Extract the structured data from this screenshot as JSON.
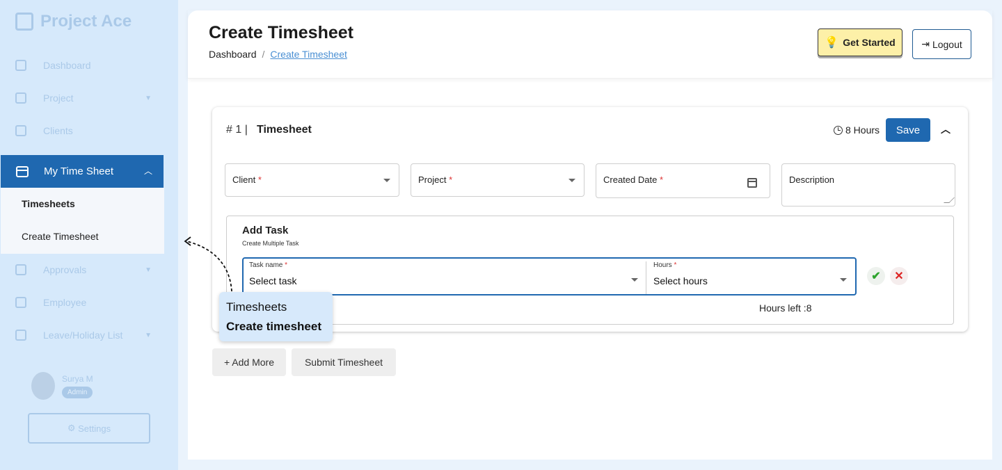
{
  "sidebar": {
    "logo_text": "Project Ace",
    "items": [
      {
        "label": "Dashboard",
        "icon": "dashboard-icon"
      },
      {
        "label": "Project",
        "icon": "project-icon"
      },
      {
        "label": "Clients",
        "icon": "clients-icon"
      },
      {
        "label": "My Time Sheet",
        "icon": "calendar-icon"
      },
      {
        "label": "Approvals",
        "icon": "approvals-icon"
      },
      {
        "label": "Employee",
        "icon": "employee-icon"
      },
      {
        "label": "Leave/Holiday List",
        "icon": "leave-icon"
      }
    ],
    "sub_items": [
      "Timesheets",
      "Create Timesheet"
    ],
    "user": {
      "name": "Surya M",
      "role": "Admin"
    },
    "settings_label": "Settings"
  },
  "header": {
    "title": "Create Timesheet",
    "breadcrumb": [
      "Dashboard",
      "/",
      "Create Timesheet"
    ],
    "get_started_label": "Get Started",
    "logout_label": "Logout"
  },
  "timesheet": {
    "number": "# 1 |",
    "title": "Timesheet",
    "hours_total": "8 Hours",
    "save_label": "Save",
    "fields": {
      "client": "Client",
      "project": "Project",
      "created_date": "Created Date",
      "description": "Description",
      "required_mark": "*"
    },
    "task": {
      "title": "Add Task",
      "subtitle": "Create Multiple Task",
      "task_name_label": "Task name",
      "task_value": "Select task",
      "hours_label": "Hours",
      "hours_value": "Select hours",
      "hours_left": "Hours left :8"
    }
  },
  "actions": {
    "add_more": "+ Add More",
    "submit": "Submit Timesheet"
  },
  "annotation": {
    "line1": "Timesheets",
    "line2": "Create timesheet"
  },
  "colors": {
    "primary": "#1f68b0",
    "sidebar_bg": "#d6e9fb",
    "get_started_bg": "#fdf0a8"
  }
}
